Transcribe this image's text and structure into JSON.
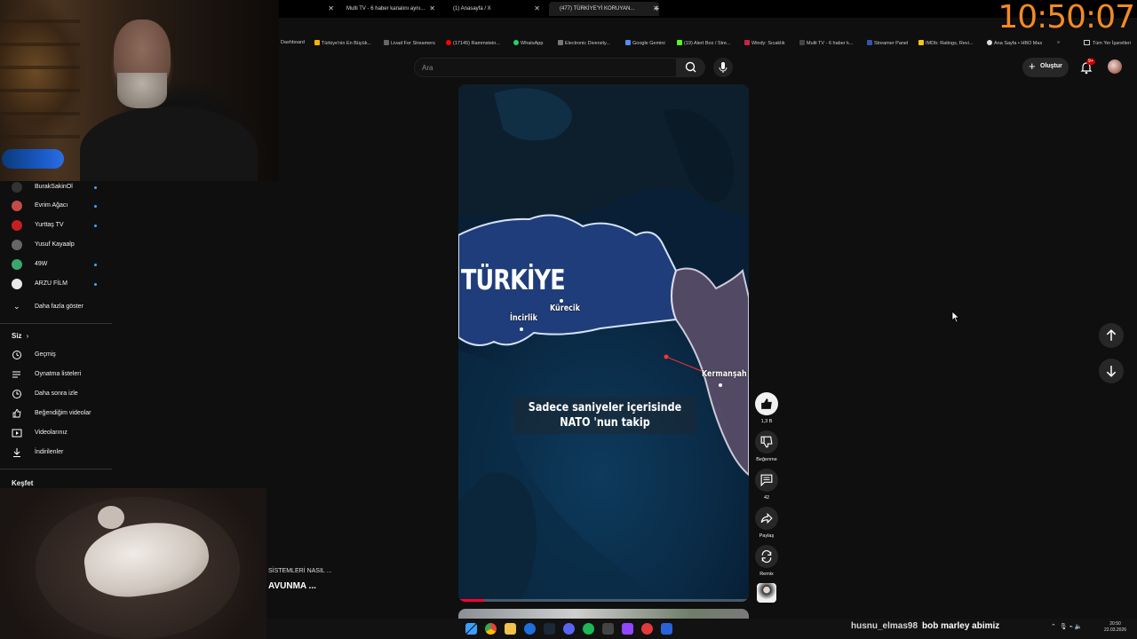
{
  "clock": "10:50:07",
  "tabs": [
    {
      "label": "Multi TV - 6 haber kanalını aynı..."
    },
    {
      "label": "(1) Anasayfa / X"
    },
    {
      "label": "(477) TÜRKİYE'Yİ KORUYAN..."
    }
  ],
  "bookmarks": [
    {
      "label": "Dashboard",
      "color": "#3a3a3a"
    },
    {
      "label": "Türkiye'nin En Büyük...",
      "color": "#f5b400"
    },
    {
      "label": "Livad For Streamers",
      "color": "#666666"
    },
    {
      "label": "(17145) Rammstein...",
      "color": "#ff0000"
    },
    {
      "label": "WhatsApp",
      "color": "#25d366"
    },
    {
      "label": "Electronic Diversity...",
      "color": "#777777"
    },
    {
      "label": "Google Gemini",
      "color": "#4f8ef7"
    },
    {
      "label": "(19) Alert Box / Stre...",
      "color": "#53fc18"
    },
    {
      "label": "Windy: Sıcaklık",
      "color": "#cc2244"
    },
    {
      "label": "Multi TV - 6 haber k...",
      "color": "#444444"
    },
    {
      "label": "Streamer Panel",
      "color": "#3355aa"
    },
    {
      "label": "IMDb: Ratings, Revi...",
      "color": "#f5c518"
    },
    {
      "label": "Ana Sayfa • HBO Max",
      "color": "#dddddd"
    }
  ],
  "all_bookmarks": "Tüm Yer İşaretleri",
  "search": {
    "placeholder": "Ara"
  },
  "create_label": "Oluştur",
  "notif_badge": "9+",
  "subscriptions": [
    {
      "name": "BurakSakinOl",
      "color": "#333333",
      "new": true
    },
    {
      "name": "Evrim Ağacı",
      "color": "#c44a4a",
      "new": true
    },
    {
      "name": "Yurttaş TV",
      "color": "#c61f1f",
      "new": true
    },
    {
      "name": "Yusuf Kayaalp",
      "color": "#666666",
      "new": false
    },
    {
      "name": "49W",
      "color": "#39a86b",
      "new": true
    },
    {
      "name": "ARZU FİLM",
      "color": "#e8e8e8",
      "new": true
    }
  ],
  "show_more": "Daha fazla göster",
  "you_section": "Siz",
  "you_items": [
    {
      "label": "Geçmiş",
      "icon": "history-icon"
    },
    {
      "label": "Oynatma listeleri",
      "icon": "playlist-icon"
    },
    {
      "label": "Daha sonra izle",
      "icon": "watch-later-icon"
    },
    {
      "label": "Beğendiğim videolar",
      "icon": "liked-icon"
    },
    {
      "label": "Videolarınız",
      "icon": "your-videos-icon"
    },
    {
      "label": "İndirilenler",
      "icon": "download-icon"
    }
  ],
  "explore": "Keşfet",
  "caption_small": "SİSTEMLERİ NASIL ...",
  "caption_big": "AVUNMA ...",
  "video": {
    "country": "TÜRKİYE",
    "places": [
      "Kürecik",
      "İncirlik",
      "Kermanşah"
    ],
    "subtitle": "Sadece saniyeler içerisinde NATO 'nun takip",
    "progress": 0.09
  },
  "actions": {
    "likes": "1,3 B",
    "dislike": "Beğenme",
    "comments": "42",
    "share": "Paylaş",
    "remix": "Remix"
  },
  "chat": {
    "user": "husnu_elmas98",
    "message": "bob marley abimiz"
  },
  "tray": {
    "time": "20:50",
    "date": "22.03.2026"
  }
}
